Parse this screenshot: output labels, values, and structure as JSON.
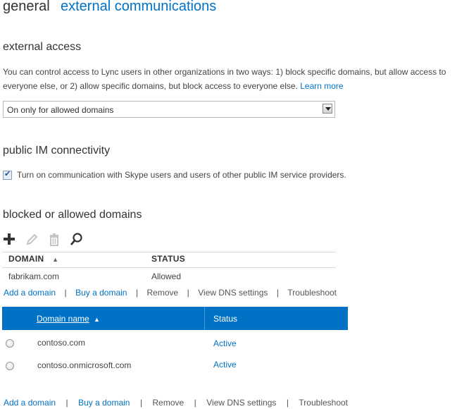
{
  "tabs": {
    "general": "general",
    "external": "external communications"
  },
  "external_access": {
    "heading": "external access",
    "description": "You can control access to Lync users in other organizations in two ways: 1) block specific domains, but allow access to everyone else, or 2) allow specific domains, but block access to everyone else.",
    "learn_more": "Learn more",
    "select_value": "On only for allowed domains"
  },
  "public_im": {
    "heading": "public IM connectivity",
    "checkbox_label": "Turn on communication with Skype users and users of other public IM service providers.",
    "checked": true
  },
  "blocked_allowed": {
    "heading": "blocked or allowed domains",
    "toolbar_icons": [
      "add-icon",
      "edit-icon",
      "delete-icon",
      "search-icon"
    ],
    "columns": {
      "domain": "DOMAIN",
      "sort_indicator": "▲",
      "status": "STATUS"
    },
    "rows": [
      {
        "domain": "fabrikam.com",
        "status": "Allowed"
      }
    ]
  },
  "actions_top": {
    "add_domain": "Add a domain",
    "buy_domain": "Buy a domain",
    "remove": "Remove",
    "view_dns": "View DNS settings",
    "troubleshoot": "Troubleshoot",
    "sep": "|"
  },
  "domains_table": {
    "col_domain_name": "Domain name",
    "sort_indicator": "▲",
    "col_status": "Status",
    "rows": [
      {
        "domain": "contoso.com",
        "status": "Active"
      },
      {
        "domain": "contoso.onmicrosoft.com",
        "status": "Active"
      }
    ]
  },
  "actions_bottom": {
    "add_domain": "Add a domain",
    "buy_domain": "Buy a domain",
    "remove": "Remove",
    "view_dns": "View DNS settings",
    "troubleshoot": "Troubleshoot",
    "sep": "|"
  },
  "colors": {
    "accent": "#0072c6",
    "header_bg": "#0072c6"
  }
}
